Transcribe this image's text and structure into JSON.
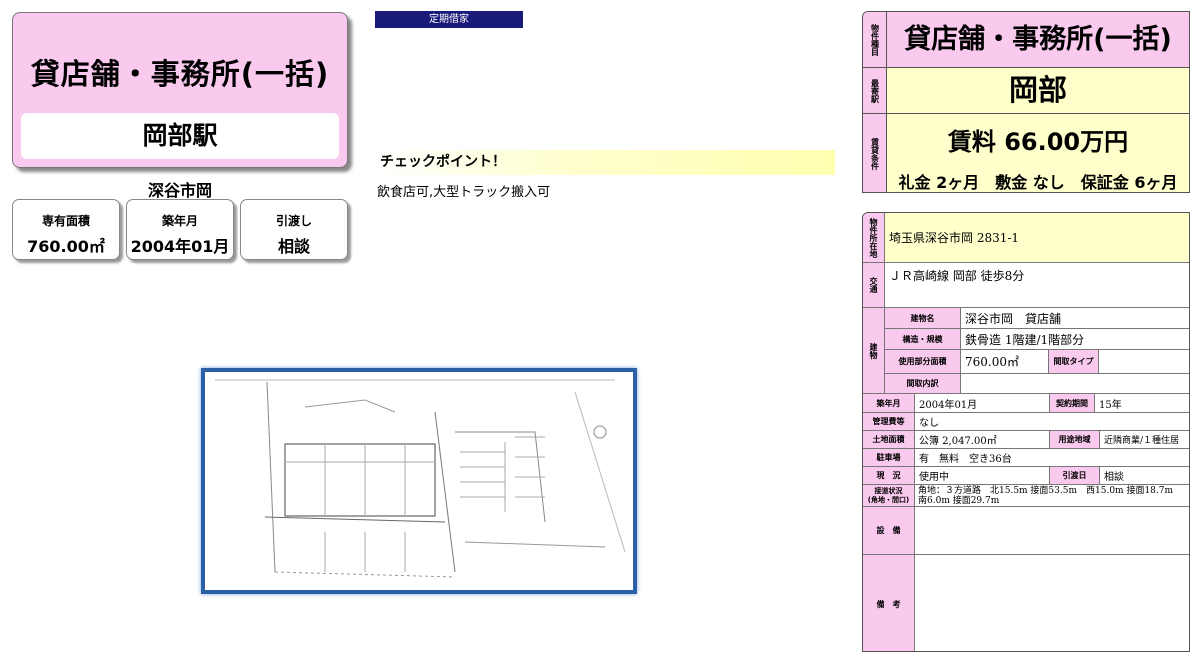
{
  "left": {
    "property_type": "貸店舗・事務所(一括)",
    "station": "岡部駅",
    "area_name": "深谷市岡",
    "stats": [
      {
        "label": "専有面積",
        "value": "760.00㎡"
      },
      {
        "label": "築年月",
        "value": "2004年01月"
      },
      {
        "label": "引渡し",
        "value": "相談"
      }
    ]
  },
  "middle": {
    "lease_badge": "定期借家",
    "checkpoint_title": "チェックポイント！",
    "checkpoint_text": "飲食店可,大型トラック搬入可"
  },
  "summary": {
    "type_side": "物件種目",
    "type_value": "貸店舗・事務所(一括)",
    "station_side": "最寄駅",
    "station_value": "岡部",
    "terms_side": "賃貸条件",
    "rent": "賃料 66.00万円",
    "deposits": "礼金 2ヶ月　敷金 なし　保証金 6ヶ月"
  },
  "details": {
    "location_label": "物件所在地",
    "location": "埼玉県深谷市岡 2831-1",
    "access_label": "交通",
    "access": "ＪＲ高崎線 岡部 徒歩8分",
    "building_label": "建物",
    "building_name_label": "建物名",
    "building_name": "深谷市岡　貸店舗",
    "structure_label": "構造・規模",
    "structure": "鉄骨造 1階建/1階部分",
    "area_label": "使用部分面積",
    "area": "760.00㎡",
    "layout_type_label": "間取タイプ",
    "layout_type": "",
    "layout_detail_label": "間取内訳",
    "layout_detail": "",
    "built_label": "築年月",
    "built": "2004年01月",
    "contract_label": "契約期間",
    "contract": "15年",
    "mgmt_label": "管理費等",
    "mgmt": "なし",
    "land_label": "土地面積",
    "land": "公簿 2,047.00㎡",
    "zoning_label": "用途地域",
    "zoning": "近隣商業/１種住居",
    "parking_label": "駐車場",
    "parking": "有　無料　空き36台",
    "status_label": "現　況",
    "status": "使用中",
    "handover_label": "引渡日",
    "handover": "相談",
    "road_label": "接道状況",
    "road_sub": "(角地・間口)",
    "road": "角地：３方道路　北15.5m 接面53.5m　西15.0m 接面18.7m　南6.0m 接面29.7m",
    "equipment_label": "設　備",
    "equipment": "",
    "remarks_label": "備　考",
    "remarks": ""
  },
  "map": {
    "icon": "site-plan-drawing"
  },
  "colors": {
    "pink": "#f9c9ee",
    "navy": "#1a1a7a",
    "map_border": "#2b5fa6",
    "checkpoint_bg": "#ffffb0"
  }
}
